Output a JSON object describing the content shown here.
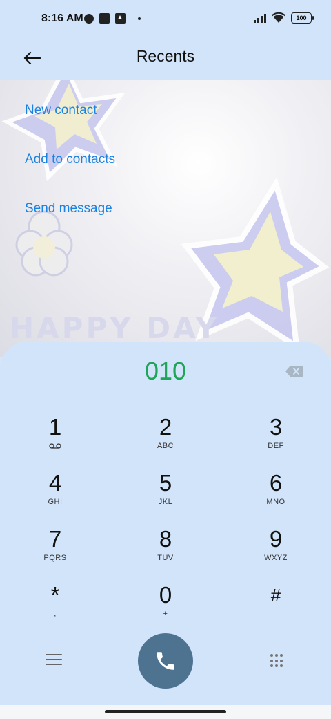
{
  "status_bar": {
    "time": "8:16 AM",
    "battery": "100"
  },
  "header": {
    "title": "Recents",
    "back_icon": "arrow-left-icon"
  },
  "actions": [
    {
      "label": "New contact"
    },
    {
      "label": "Add to contacts"
    },
    {
      "label": "Send message"
    }
  ],
  "wallpaper": {
    "text": "HAPPY DAY"
  },
  "dialer": {
    "number": "010",
    "number_color": "#1ea55a",
    "keys": [
      {
        "digit": "1",
        "letters": "voicemail-icon"
      },
      {
        "digit": "2",
        "letters": "ABC"
      },
      {
        "digit": "3",
        "letters": "DEF"
      },
      {
        "digit": "4",
        "letters": "GHI"
      },
      {
        "digit": "5",
        "letters": "JKL"
      },
      {
        "digit": "6",
        "letters": "MNO"
      },
      {
        "digit": "7",
        "letters": "PQRS"
      },
      {
        "digit": "8",
        "letters": "TUV"
      },
      {
        "digit": "9",
        "letters": "WXYZ"
      },
      {
        "digit": "*",
        "letters": ","
      },
      {
        "digit": "0",
        "letters": "+"
      },
      {
        "digit": "#",
        "letters": ""
      }
    ],
    "call_color": "#4d7391"
  }
}
